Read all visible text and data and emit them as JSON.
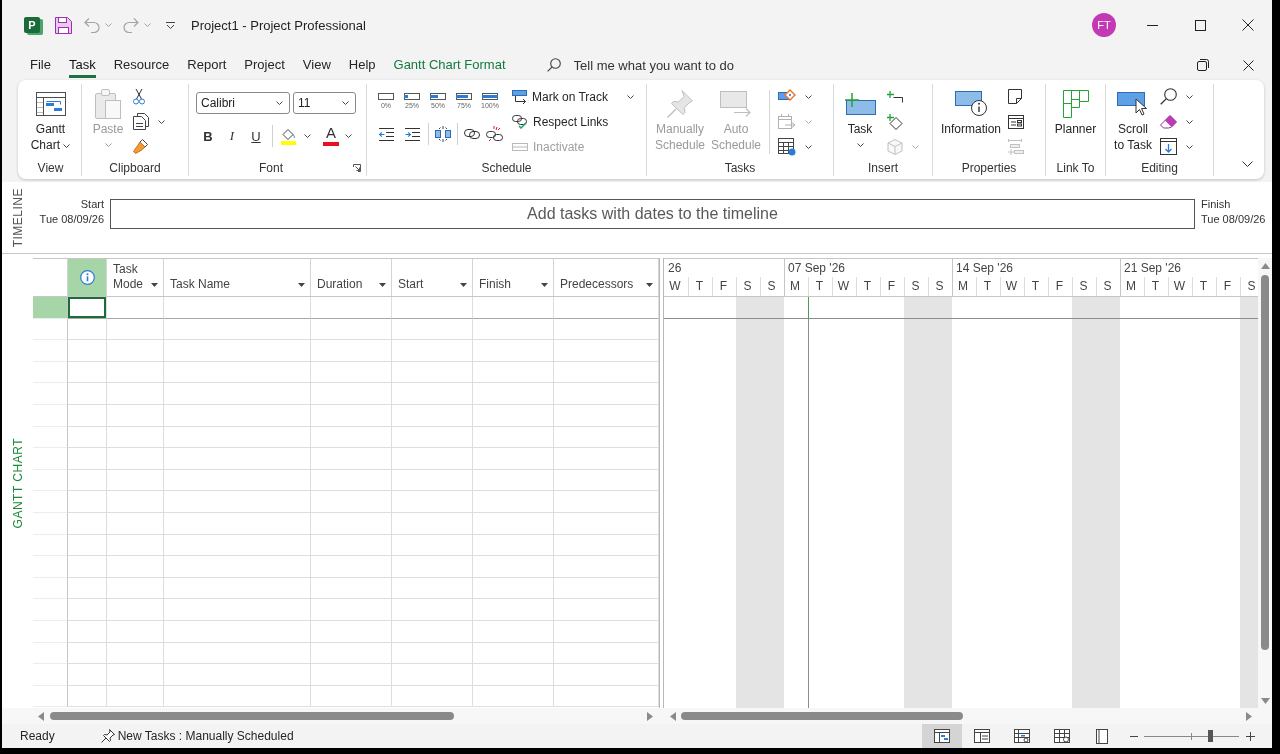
{
  "title_bar": {
    "logo_text": "P",
    "quick_access": [
      {
        "disabled": false
      },
      {
        "disabled": true
      },
      {
        "disabled": true
      }
    ],
    "title": "Project1 - Project Professional",
    "user_initials": "FT"
  },
  "menu_tabs": [
    {
      "label": "File",
      "kind": "standard",
      "selected": false
    },
    {
      "label": "Task",
      "kind": "standard",
      "selected": true
    },
    {
      "label": "Resource",
      "kind": "standard",
      "selected": false
    },
    {
      "label": "Report",
      "kind": "standard",
      "selected": false
    },
    {
      "label": "Project",
      "kind": "standard",
      "selected": false
    },
    {
      "label": "View",
      "kind": "standard",
      "selected": false
    },
    {
      "label": "Help",
      "kind": "standard",
      "selected": false
    },
    {
      "label": "Gantt Chart Format",
      "kind": "contextual",
      "selected": false
    }
  ],
  "search": {
    "placeholder": "Tell me what you want to do"
  },
  "ribbon": {
    "groups": [
      {
        "label": "View",
        "buttons": [
          {
            "label": "Gantt Chart",
            "disabled": false
          }
        ]
      },
      {
        "label": "Clipboard",
        "buttons": [
          {
            "label": "Paste",
            "disabled": true
          }
        ]
      },
      {
        "label": "Font",
        "font_name": "Calibri",
        "font_size": "11",
        "styles": [
          "B",
          "I",
          "U"
        ],
        "font_color": "A"
      },
      {
        "label": "Schedule",
        "percent": [
          {
            "label": "0%"
          },
          {
            "label": "25%",
            "level": 0.25
          },
          {
            "label": "50%",
            "level": 0.5
          },
          {
            "label": "75%",
            "level": 0.75
          },
          {
            "label": "100%",
            "level": 1
          }
        ],
        "buttons": [
          {
            "label": "Mark on Track",
            "disabled": false
          },
          {
            "label": "Respect Links",
            "disabled": false
          },
          {
            "label": "Inactivate",
            "disabled": true
          }
        ]
      },
      {
        "label": "Tasks",
        "buttons": [
          {
            "label": "Manually Schedule",
            "disabled": true
          },
          {
            "label": "Auto Schedule",
            "disabled": true
          }
        ],
        "tools": [
          {
            "disabled": false
          },
          {
            "disabled": true
          },
          {
            "disabled": false
          }
        ]
      },
      {
        "label": "Insert",
        "buttons": [
          {
            "label": "Task",
            "disabled": false
          }
        ],
        "tools": [
          {
            "disabled": false
          },
          {
            "disabled": false
          },
          {
            "disabled": true
          }
        ]
      },
      {
        "label": "Properties",
        "buttons": [
          {
            "label": "Information",
            "disabled": false
          }
        ],
        "tools": [
          {
            "disabled": false
          },
          {
            "disabled": false
          },
          {
            "disabled": true
          }
        ]
      },
      {
        "label": "Link To",
        "buttons": [
          {
            "label": "Planner",
            "disabled": false
          }
        ]
      },
      {
        "label": "Editing",
        "buttons": [
          {
            "label": "Scroll to Task",
            "disabled": false
          }
        ]
      }
    ]
  },
  "timeline": {
    "label": "TIMELINE",
    "start_label": "Start",
    "start_date": "Tue 08/09/26",
    "message": "Add tasks with dates to the timeline",
    "finish_label": "Finish",
    "finish_date": "Tue 08/09/26"
  },
  "gantt": {
    "view_label": "GANTT CHART",
    "columns": [
      {
        "kind": "icon",
        "selected": true
      },
      {
        "kind": "text",
        "label": "Task Mode",
        "selected": false
      },
      {
        "kind": "text",
        "label": "Task Name",
        "selected": false
      },
      {
        "kind": "text",
        "label": "Duration",
        "selected": false
      },
      {
        "kind": "text",
        "label": "Start",
        "selected": false
      },
      {
        "kind": "text",
        "label": "Finish",
        "selected": false
      },
      {
        "kind": "text",
        "label": "Predecessors",
        "selected": false
      }
    ],
    "rows": [
      {
        "selected": true
      },
      {
        "selected": false
      },
      {
        "selected": false
      },
      {
        "selected": false
      },
      {
        "selected": false
      },
      {
        "selected": false
      },
      {
        "selected": false
      },
      {
        "selected": false
      },
      {
        "selected": false
      },
      {
        "selected": false
      },
      {
        "selected": false
      },
      {
        "selected": false
      },
      {
        "selected": false
      },
      {
        "selected": false
      },
      {
        "selected": false
      },
      {
        "selected": false
      },
      {
        "selected": false
      },
      {
        "selected": false
      },
      {
        "selected": false
      }
    ],
    "timescale": {
      "weeks": [
        {
          "label": "26",
          "days": [
            {
              "label": "W",
              "nonworking": false,
              "today": false
            },
            {
              "label": "T",
              "nonworking": false,
              "today": false
            },
            {
              "label": "F",
              "nonworking": false,
              "today": false
            },
            {
              "label": "S",
              "nonworking": true,
              "today": false
            },
            {
              "label": "S",
              "nonworking": true,
              "today": false
            }
          ]
        },
        {
          "label": "07 Sep '26",
          "days": [
            {
              "label": "M",
              "nonworking": false,
              "today": false
            },
            {
              "label": "T",
              "nonworking": false,
              "today": true
            },
            {
              "label": "W",
              "nonworking": false,
              "today": false
            },
            {
              "label": "T",
              "nonworking": false,
              "today": false
            },
            {
              "label": "F",
              "nonworking": false,
              "today": false
            },
            {
              "label": "S",
              "nonworking": true,
              "today": false
            },
            {
              "label": "S",
              "nonworking": true,
              "today": false
            }
          ]
        },
        {
          "label": "14 Sep '26",
          "days": [
            {
              "label": "M",
              "nonworking": false,
              "today": false
            },
            {
              "label": "T",
              "nonworking": false,
              "today": false
            },
            {
              "label": "W",
              "nonworking": false,
              "today": false
            },
            {
              "label": "T",
              "nonworking": false,
              "today": false
            },
            {
              "label": "F",
              "nonworking": false,
              "today": false
            },
            {
              "label": "S",
              "nonworking": true,
              "today": false
            },
            {
              "label": "S",
              "nonworking": true,
              "today": false
            }
          ]
        },
        {
          "label": "21 Sep '26",
          "days": [
            {
              "label": "M",
              "nonworking": false,
              "today": false
            },
            {
              "label": "T",
              "nonworking": false,
              "today": false
            },
            {
              "label": "W",
              "nonworking": false,
              "today": false
            },
            {
              "label": "T",
              "nonworking": false,
              "today": false
            },
            {
              "label": "F",
              "nonworking": false,
              "today": false
            },
            {
              "label": "S",
              "nonworking": true,
              "today": false
            }
          ]
        }
      ]
    }
  },
  "status_bar": {
    "status": "Ready",
    "new_tasks": "New Tasks : Manually Scheduled",
    "views": [
      {
        "selected": true
      },
      {
        "selected": false
      },
      {
        "selected": false
      },
      {
        "selected": false
      },
      {
        "selected": false
      }
    ],
    "zoom": {
      "level": 0.7
    }
  }
}
